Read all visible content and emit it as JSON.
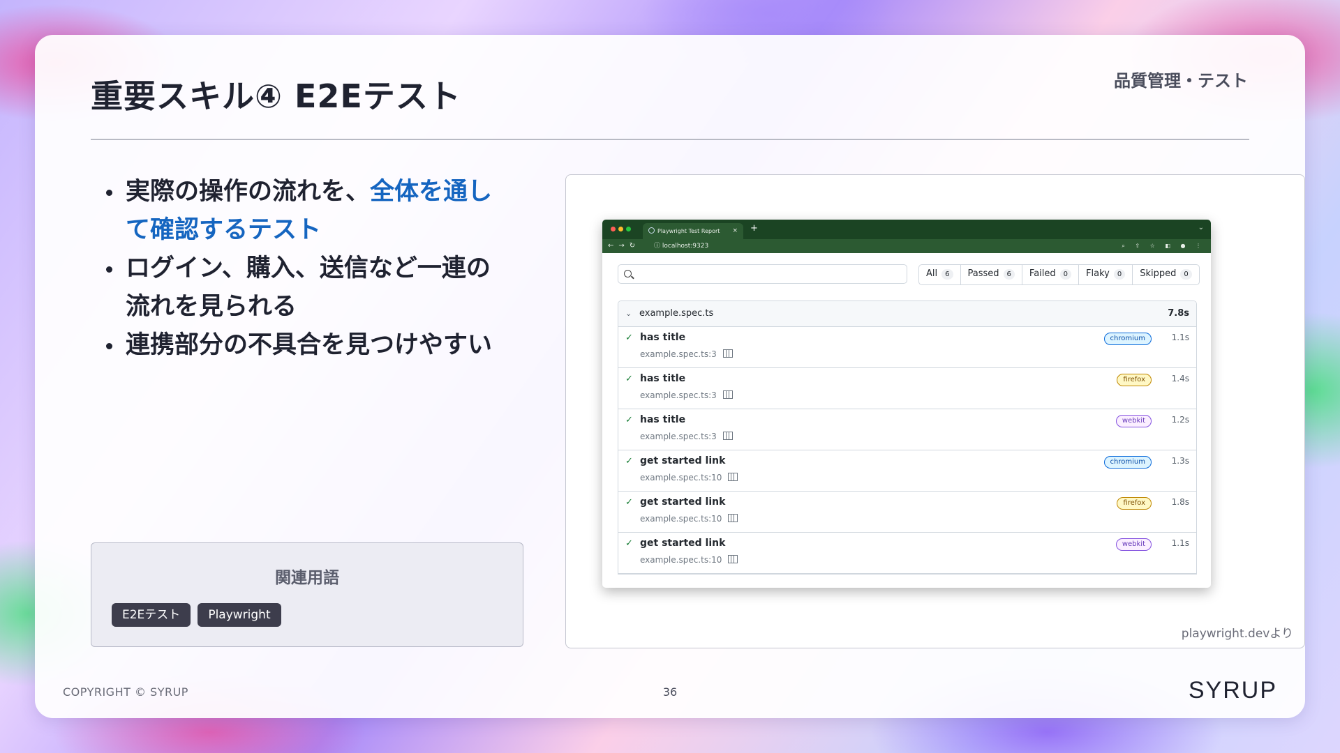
{
  "slide": {
    "title": "重要スキル④ E2Eテスト",
    "category": "品質管理・テスト",
    "bullets": [
      {
        "text": "実際の操作の流れを、",
        "highlight": "全体を通して確認するテスト"
      },
      {
        "text": "ログイン、購入、送信など一連の流れを見られる",
        "highlight": ""
      },
      {
        "text": "連携部分の不具合を見つけやすい",
        "highlight": ""
      }
    ],
    "related": {
      "title": "関連用語",
      "terms": [
        "E2Eテスト",
        "Playwright"
      ]
    },
    "image_credit": "playwright.devより",
    "copyright": "COPYRIGHT © SYRUP",
    "page_number": "36",
    "logo": "SYRUP",
    "accent_color": "#1565c0"
  },
  "browser": {
    "tab_title": "Playwright Test Report",
    "tab_close": "×",
    "new_tab": "+",
    "url": "localhost:9323",
    "filters": [
      {
        "label": "All",
        "count": "6"
      },
      {
        "label": "Passed",
        "count": "6"
      },
      {
        "label": "Failed",
        "count": "0"
      },
      {
        "label": "Flaky",
        "count": "0"
      },
      {
        "label": "Skipped",
        "count": "0"
      }
    ],
    "file": {
      "name": "example.spec.ts",
      "time": "7.8s"
    },
    "tests": [
      {
        "name": "has title",
        "location": "example.spec.ts:3",
        "browser": "chromium",
        "time": "1.1s"
      },
      {
        "name": "has title",
        "location": "example.spec.ts:3",
        "browser": "firefox",
        "time": "1.4s"
      },
      {
        "name": "has title",
        "location": "example.spec.ts:3",
        "browser": "webkit",
        "time": "1.2s"
      },
      {
        "name": "get started link",
        "location": "example.spec.ts:10",
        "browser": "chromium",
        "time": "1.3s"
      },
      {
        "name": "get started link",
        "location": "example.spec.ts:10",
        "browser": "firefox",
        "time": "1.8s"
      },
      {
        "name": "get started link",
        "location": "example.spec.ts:10",
        "browser": "webkit",
        "time": "1.1s"
      }
    ]
  }
}
